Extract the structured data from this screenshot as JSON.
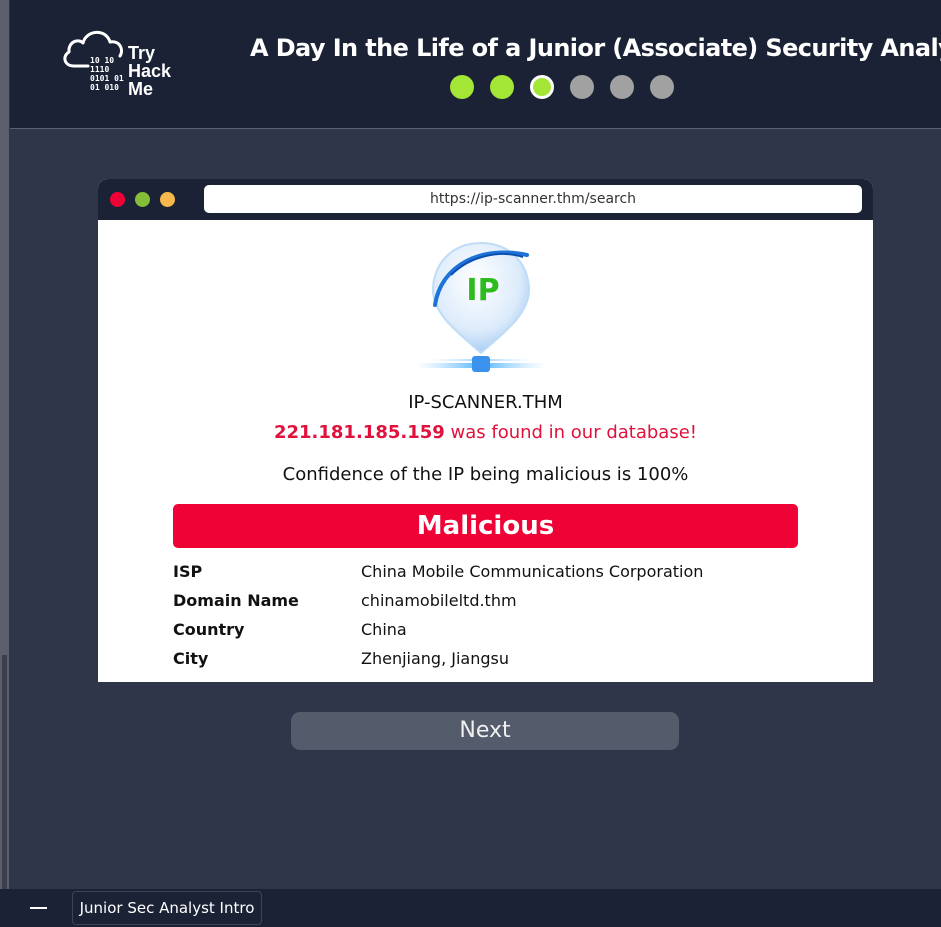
{
  "header": {
    "logo_bits": [
      "10  10",
      "1110",
      "0101  01",
      " 01  010"
    ],
    "logo_lines": [
      "Try",
      "Hack",
      "Me"
    ],
    "title": "A Day In the Life of a Junior (Associate) Security Analyst",
    "progress": {
      "steps": [
        {
          "state": "done"
        },
        {
          "state": "done"
        },
        {
          "state": "current"
        },
        {
          "state": "pending"
        },
        {
          "state": "pending"
        },
        {
          "state": "pending"
        }
      ],
      "colors": {
        "done": "#a3e635",
        "current": "#a3e635",
        "pending": "#a1a1a1"
      }
    }
  },
  "browser": {
    "url": "https://ip-scanner.thm/search",
    "window_buttons": [
      "close",
      "minimize",
      "maximize"
    ],
    "logo_text": "IP",
    "site_name": "IP-SCANNER.THM",
    "ip": "221.181.185.159",
    "found_suffix": " was found in our database!",
    "confidence": "Confidence of the IP being malicious is 100%",
    "verdict": "Malicious",
    "details": [
      {
        "key": "ISP",
        "value": "China Mobile Communications Corporation"
      },
      {
        "key": "Domain Name",
        "value": "chinamobileltd.thm"
      },
      {
        "key": "Country",
        "value": "China"
      },
      {
        "key": "City",
        "value": "Zhenjiang, Jiangsu"
      }
    ]
  },
  "next_button": "Next",
  "taskbar": {
    "tab_label": "Junior Sec Analyst Intro"
  },
  "colors": {
    "accent_red": "#ef0236",
    "header_bg": "#1b2235",
    "page_bg": "#2f3649"
  }
}
